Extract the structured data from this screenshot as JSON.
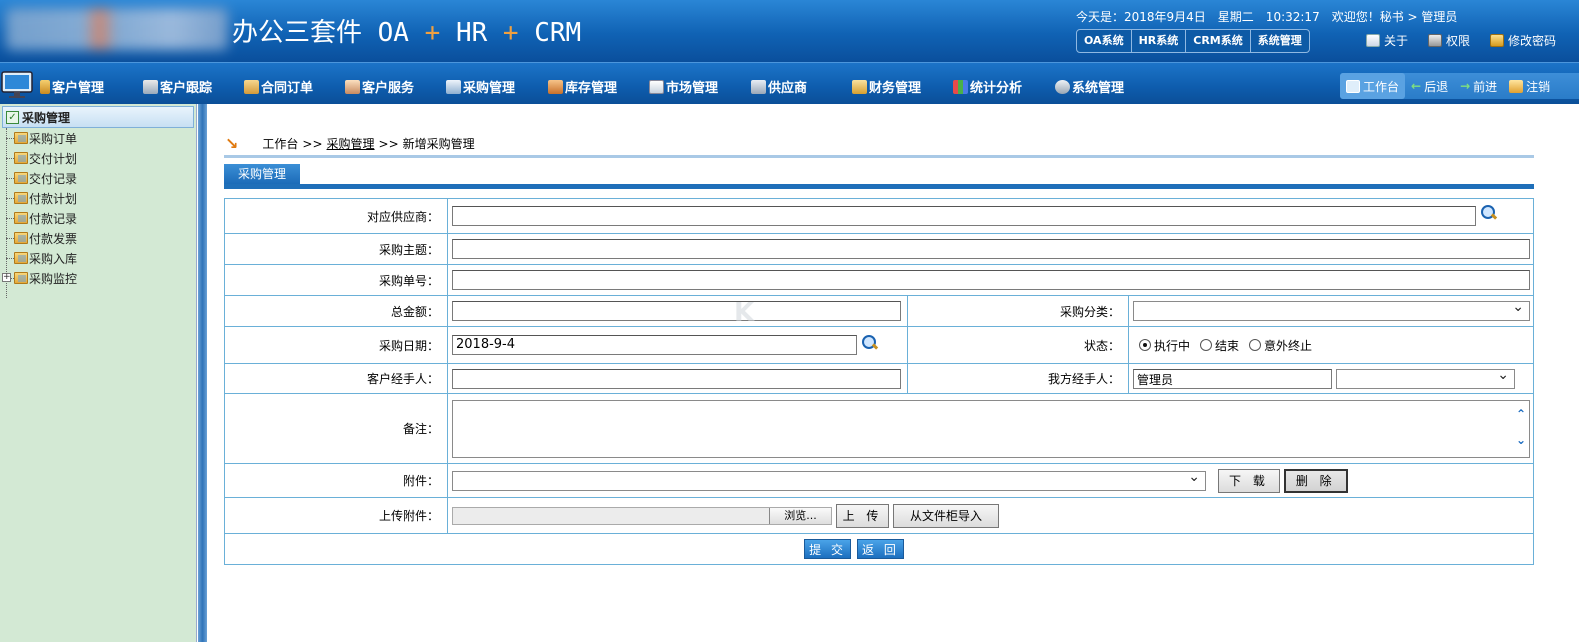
{
  "header": {
    "title_parts": [
      "办公三套件 OA",
      "+",
      "HR",
      "+",
      "CRM"
    ],
    "datetime": "今天是：2018年9月4日　星期二　10:32:17　欢迎您！秘书 > 管理员",
    "sys_tabs": [
      "OA系统",
      "HR系统",
      "CRM系统",
      "系统管理"
    ],
    "links": [
      {
        "label": "关于",
        "icon": "document-icon"
      },
      {
        "label": "权限",
        "icon": "printer-icon"
      },
      {
        "label": "修改密码",
        "icon": "key-icon"
      }
    ]
  },
  "nav": {
    "items": [
      "客户管理",
      "客户跟踪",
      "合同订单",
      "客户服务",
      "采购管理",
      "库存管理",
      "市场管理",
      "供应商",
      "财务管理",
      "统计分析",
      "系统管理"
    ],
    "right": [
      "工作台",
      "后退",
      "前进",
      "注销"
    ]
  },
  "sidebar": {
    "title": "采购管理",
    "items": [
      "采购订单",
      "交付计划",
      "交付记录",
      "付款计划",
      "付款记录",
      "付款发票",
      "采购入库",
      "采购监控"
    ]
  },
  "breadcrumb": {
    "home": "工作台",
    "sep1": ">>",
    "module": "采购管理",
    "sep2": ">>",
    "page": "新增采购管理"
  },
  "section_title": "采购管理",
  "form": {
    "supplier_label": "对应供应商：",
    "subject_label": "采购主题：",
    "order_no_label": "采购单号：",
    "total_label": "总金额：",
    "category_label": "采购分类：",
    "date_label": "采购日期：",
    "date_value": "2018-9-4",
    "status_label": "状态：",
    "status_options": [
      "执行中",
      "结束",
      "意外终止"
    ],
    "client_handler_label": "客户经手人：",
    "our_handler_label": "我方经手人：",
    "our_handler_value": "管理员",
    "remark_label": "备注：",
    "attachment_label": "附件：",
    "download_btn": "下 载",
    "delete_btn": "删 除",
    "upload_label": "上传附件：",
    "browse_btn": "浏览...",
    "upload_btn": "上 传",
    "import_btn": "从文件柜导入",
    "submit_btn": "提 交",
    "back_btn": "返 回"
  }
}
